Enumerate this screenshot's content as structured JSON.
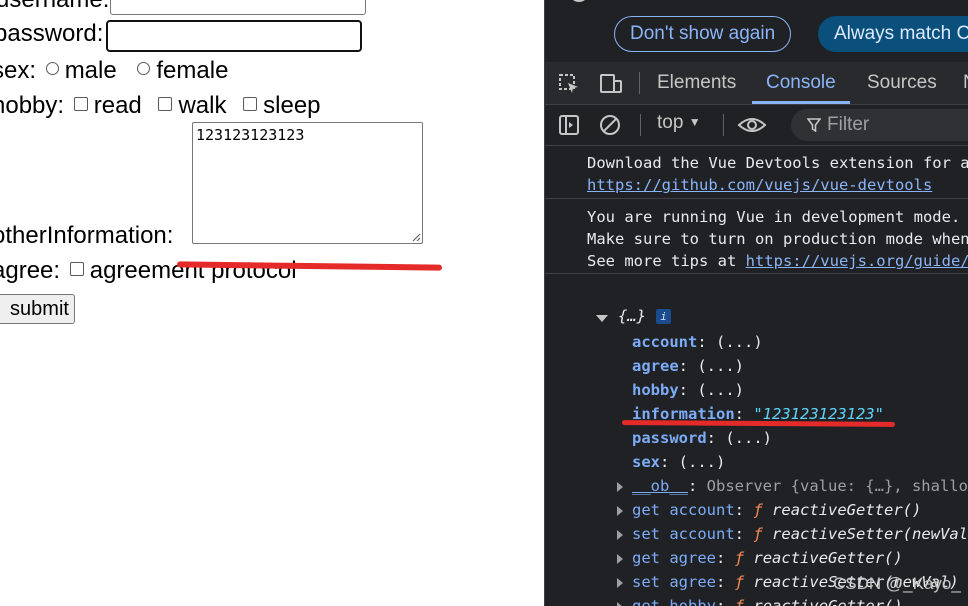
{
  "form": {
    "username_label": "username:",
    "password_label": "password:",
    "sex_label": "sex:",
    "sex_options": [
      "male",
      "female"
    ],
    "hobby_label": "hobby:",
    "hobby_options": [
      "read",
      "walk",
      "sleep"
    ],
    "other_label": "otherInformation:",
    "other_value": "123123123123",
    "agree_label": "agree:",
    "agree_text": "agreement protocol",
    "submit_label": "submit"
  },
  "devtools": {
    "banner": {
      "dont_show": "Don't show again",
      "always_match": "Always match C"
    },
    "tabs": [
      "Elements",
      "Console",
      "Sources",
      "N"
    ],
    "active_tab": "Console",
    "toolbar": {
      "context": "top",
      "filter_placeholder": "Filter"
    },
    "messages": {
      "devtools_ext": "Download the Vue Devtools extension for a b",
      "devtools_link": "https://github.com/vuejs/vue-devtools",
      "dev_mode_1": "You are running Vue in development mode.",
      "dev_mode_2": "Make sure to turn on production mode when d",
      "dev_mode_3_prefix": "See more tips at ",
      "dev_mode_3_link": "https://vuejs.org/guide/de"
    },
    "object": {
      "summary": "{…}",
      "badge": "i",
      "props": [
        {
          "key": "account",
          "value": "(...)"
        },
        {
          "key": "agree",
          "value": "(...)"
        },
        {
          "key": "hobby",
          "value": "(...)"
        },
        {
          "key": "information",
          "value": "\"123123123123\""
        },
        {
          "key": "password",
          "value": "(...)"
        },
        {
          "key": "sex",
          "value": "(...)"
        }
      ],
      "ob_key": "__ob__",
      "ob_value": "Observer  {value: {…}, shallo",
      "accessors": [
        {
          "kind": "get",
          "name": "account",
          "fn": "reactiveGetter()"
        },
        {
          "kind": "set",
          "name": "account",
          "fn": "reactiveSetter(newVal)"
        },
        {
          "kind": "get",
          "name": "agree",
          "fn": "reactiveGetter()"
        },
        {
          "kind": "set",
          "name": "agree",
          "fn": "reactiveSetter(newVal)"
        },
        {
          "kind": "get",
          "name": "hobby",
          "fn": "reactiveGetter()"
        }
      ],
      "f_symbol": "ƒ"
    },
    "watermark": "CSDN @_Kayo_"
  },
  "annotations": {
    "underline_color": "#e52a2a"
  }
}
